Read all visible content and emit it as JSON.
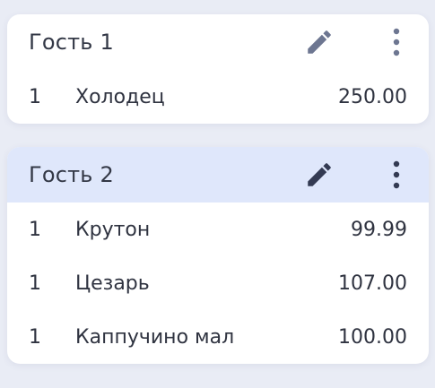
{
  "guests": [
    {
      "name": "Гость 1",
      "highlighted": false,
      "icon_color": "#6d7691",
      "items": [
        {
          "qty": "1",
          "name": "Холодец",
          "price": "250.00"
        }
      ]
    },
    {
      "name": "Гость 2",
      "highlighted": true,
      "icon_color": "#333a52",
      "items": [
        {
          "qty": "1",
          "name": "Крутон",
          "price": "99.99"
        },
        {
          "qty": "1",
          "name": "Цезарь",
          "price": "107.00"
        },
        {
          "qty": "1",
          "name": "Каппучино мал",
          "price": "100.00"
        }
      ]
    }
  ],
  "icons": {
    "edit": "pencil-icon",
    "menu": "more-vertical-icon"
  },
  "colors": {
    "background": "#e9ecf5",
    "card": "#ffffff",
    "highlight_header": "#dfe7fb",
    "text": "#2f3340"
  }
}
